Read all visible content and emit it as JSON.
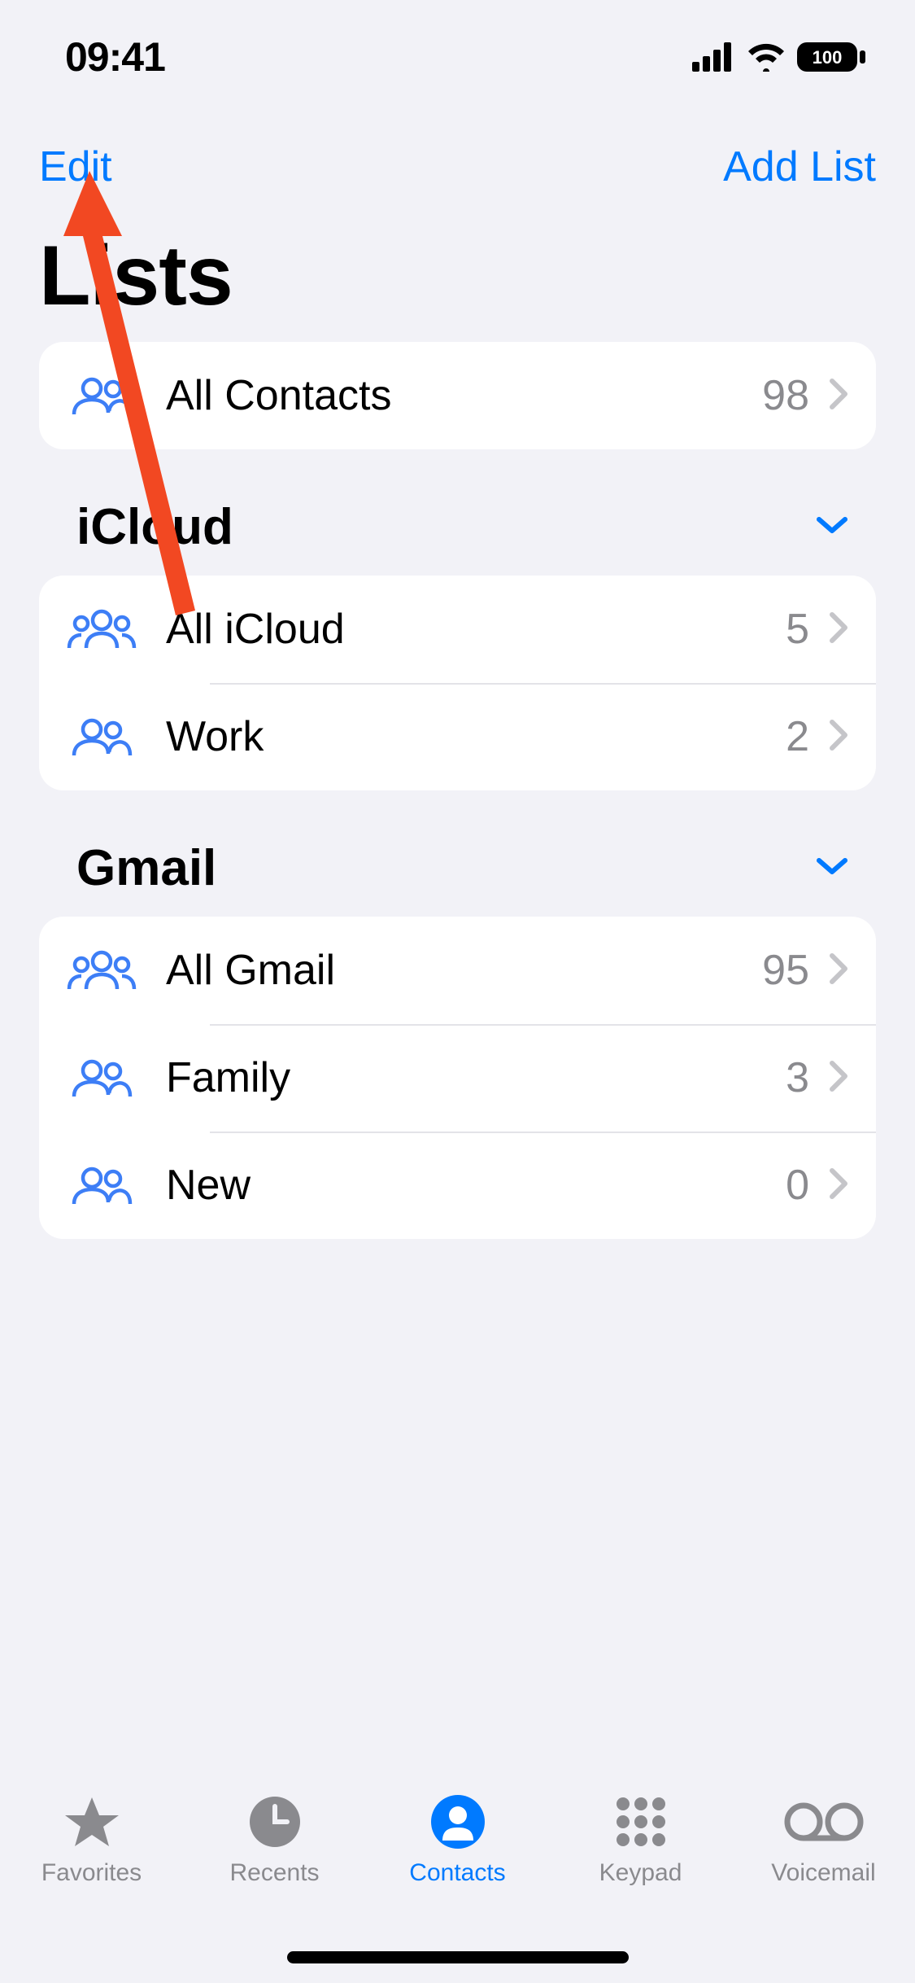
{
  "status": {
    "time": "09:41",
    "battery": "100"
  },
  "nav": {
    "edit": "Edit",
    "addList": "Add List"
  },
  "title": "Lists",
  "allContacts": {
    "label": "All Contacts",
    "count": "98"
  },
  "sections": [
    {
      "title": "iCloud",
      "items": [
        {
          "label": "All iCloud",
          "count": "5",
          "icon": "group3"
        },
        {
          "label": "Work",
          "count": "2",
          "icon": "group2"
        }
      ]
    },
    {
      "title": "Gmail",
      "items": [
        {
          "label": "All Gmail",
          "count": "95",
          "icon": "group3"
        },
        {
          "label": "Family",
          "count": "3",
          "icon": "group2"
        },
        {
          "label": "New",
          "count": "0",
          "icon": "group2"
        }
      ]
    }
  ],
  "tabs": {
    "favorites": "Favorites",
    "recents": "Recents",
    "contacts": "Contacts",
    "keypad": "Keypad",
    "voicemail": "Voicemail",
    "activeIndex": 2
  },
  "colors": {
    "accent": "#007aff",
    "secondary": "#8a8a8e",
    "bg": "#f2f2f7",
    "annotation": "#f24822"
  }
}
